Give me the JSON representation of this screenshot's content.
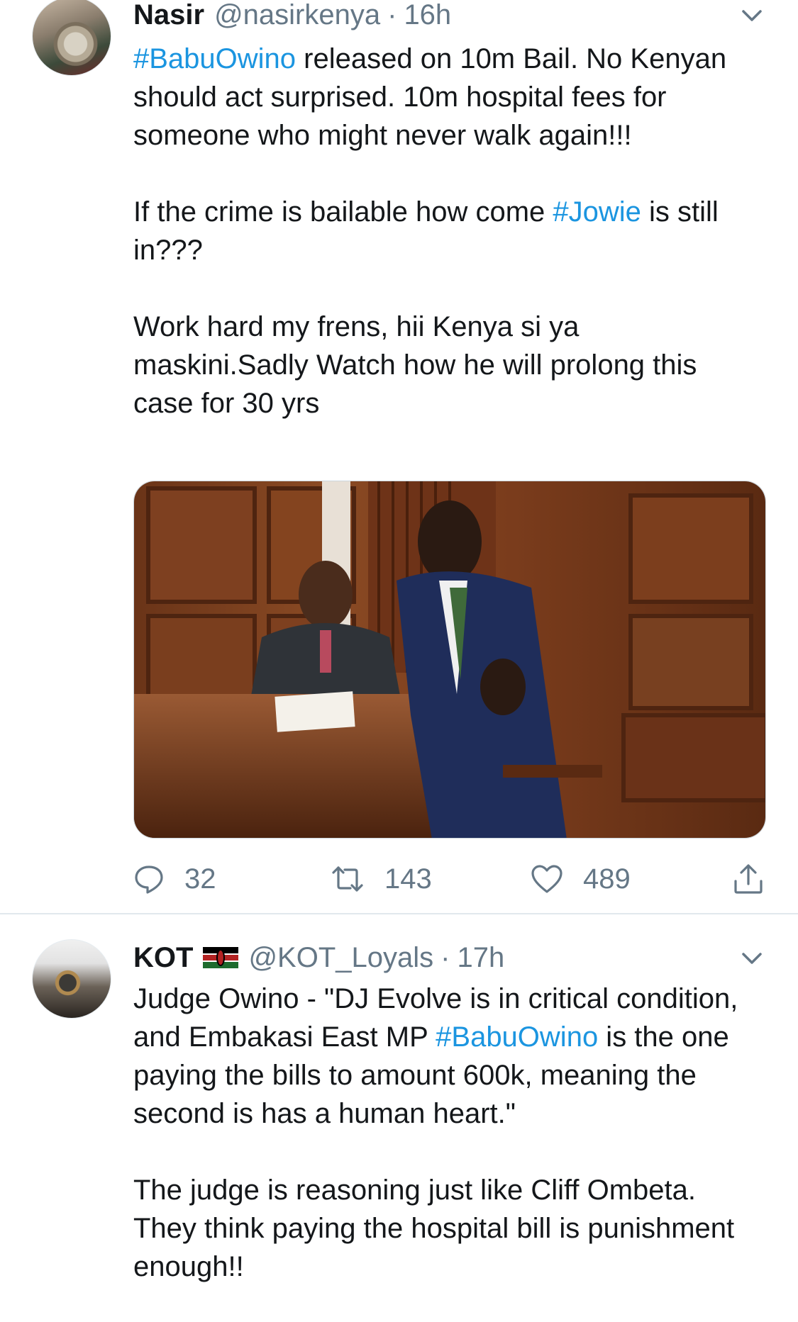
{
  "tweets": [
    {
      "name": "Nasir",
      "handle": "@nasirkenya",
      "separator": "·",
      "time": "16h",
      "paragraphs": [
        {
          "parts": [
            {
              "text": "#BabuOwino",
              "hashtag": true
            },
            {
              "text": " released on 10m Bail. No Kenyan should act surprised. 10m hospital fees for someone who might never walk again!!!",
              "hashtag": false
            }
          ]
        },
        {
          "parts": [
            {
              "text": "If the crime is bailable how come ",
              "hashtag": false
            },
            {
              "text": "#Jowie",
              "hashtag": true
            },
            {
              "text": " is still in???",
              "hashtag": false
            }
          ]
        },
        {
          "parts": [
            {
              "text": "Work hard my frens, hii Kenya si ya maskini.Sadly Watch how he will prolong this case for 30 yrs",
              "hashtag": false
            }
          ]
        }
      ],
      "reply_count": "32",
      "retweet_count": "143",
      "like_count": "489"
    },
    {
      "name": "KOT",
      "handle": "@KOT_Loyals",
      "separator": "·",
      "time": "17h",
      "paragraphs": [
        {
          "parts": [
            {
              "text": "Judge Owino - \"DJ Evolve is in critical condition, and Embakasi East MP ",
              "hashtag": false
            },
            {
              "text": "#BabuOwino",
              "hashtag": true
            },
            {
              "text": " is the one paying the bills to amount 600k, meaning the second is has a human heart.\"",
              "hashtag": false
            }
          ]
        },
        {
          "parts": [
            {
              "text": "The judge is reasoning just like Cliff Ombeta. They think paying the hospital bill is punishment enough!!",
              "hashtag": false
            }
          ]
        }
      ]
    }
  ],
  "colors": {
    "hashtag": "#1b95e0",
    "secondary_text": "#657786",
    "divider": "#e1e8ed"
  },
  "icons": {
    "reply": "reply-icon",
    "retweet": "retweet-icon",
    "like": "heart-icon",
    "share": "share-icon",
    "more": "chevron-down-icon",
    "flag": "kenya-flag-icon"
  }
}
